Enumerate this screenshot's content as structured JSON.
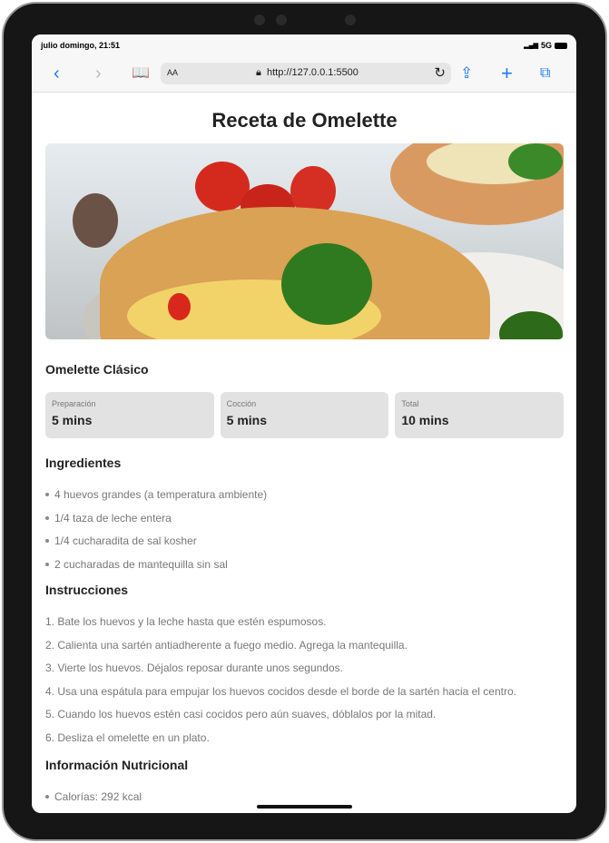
{
  "status": {
    "time": "julio domingo, 21:51",
    "network": "5G"
  },
  "browser": {
    "text_size": "AA",
    "url": "http://127.0.0.1:5500"
  },
  "page": {
    "title": "Receta de Omelette",
    "subtitle": "Omelette Clásico",
    "times": [
      {
        "label": "Preparación",
        "value": "5 mins"
      },
      {
        "label": "Cocción",
        "value": "5 mins"
      },
      {
        "label": "Total",
        "value": "10 mins"
      }
    ],
    "ingredients_title": "Ingredientes",
    "ingredients": [
      "4 huevos grandes (a temperatura ambiente)",
      "1/4 taza de leche entera",
      "1/4 cucharadita de sal kosher",
      "2 cucharadas de mantequilla sin sal"
    ],
    "instructions_title": "Instrucciones",
    "instructions": [
      "1. Bate los huevos y la leche hasta que estén espumosos.",
      "2. Calienta una sartén antiadherente a fuego medio. Agrega la mantequilla.",
      "3. Vierte los huevos. Déjalos reposar durante unos segundos.",
      "4. Usa una espátula para empujar los huevos cocidos desde el borde de la sartén hacia el centro.",
      "5. Cuando los huevos estén casi cocidos pero aún suaves, dóblalos por la mitad.",
      "6. Desliza el omelette en un plato."
    ],
    "nutrition_title": "Información Nutricional",
    "nutrition": [
      "Calorías: 292 kcal"
    ]
  },
  "colors": {
    "accent": "#1a7cf5"
  }
}
